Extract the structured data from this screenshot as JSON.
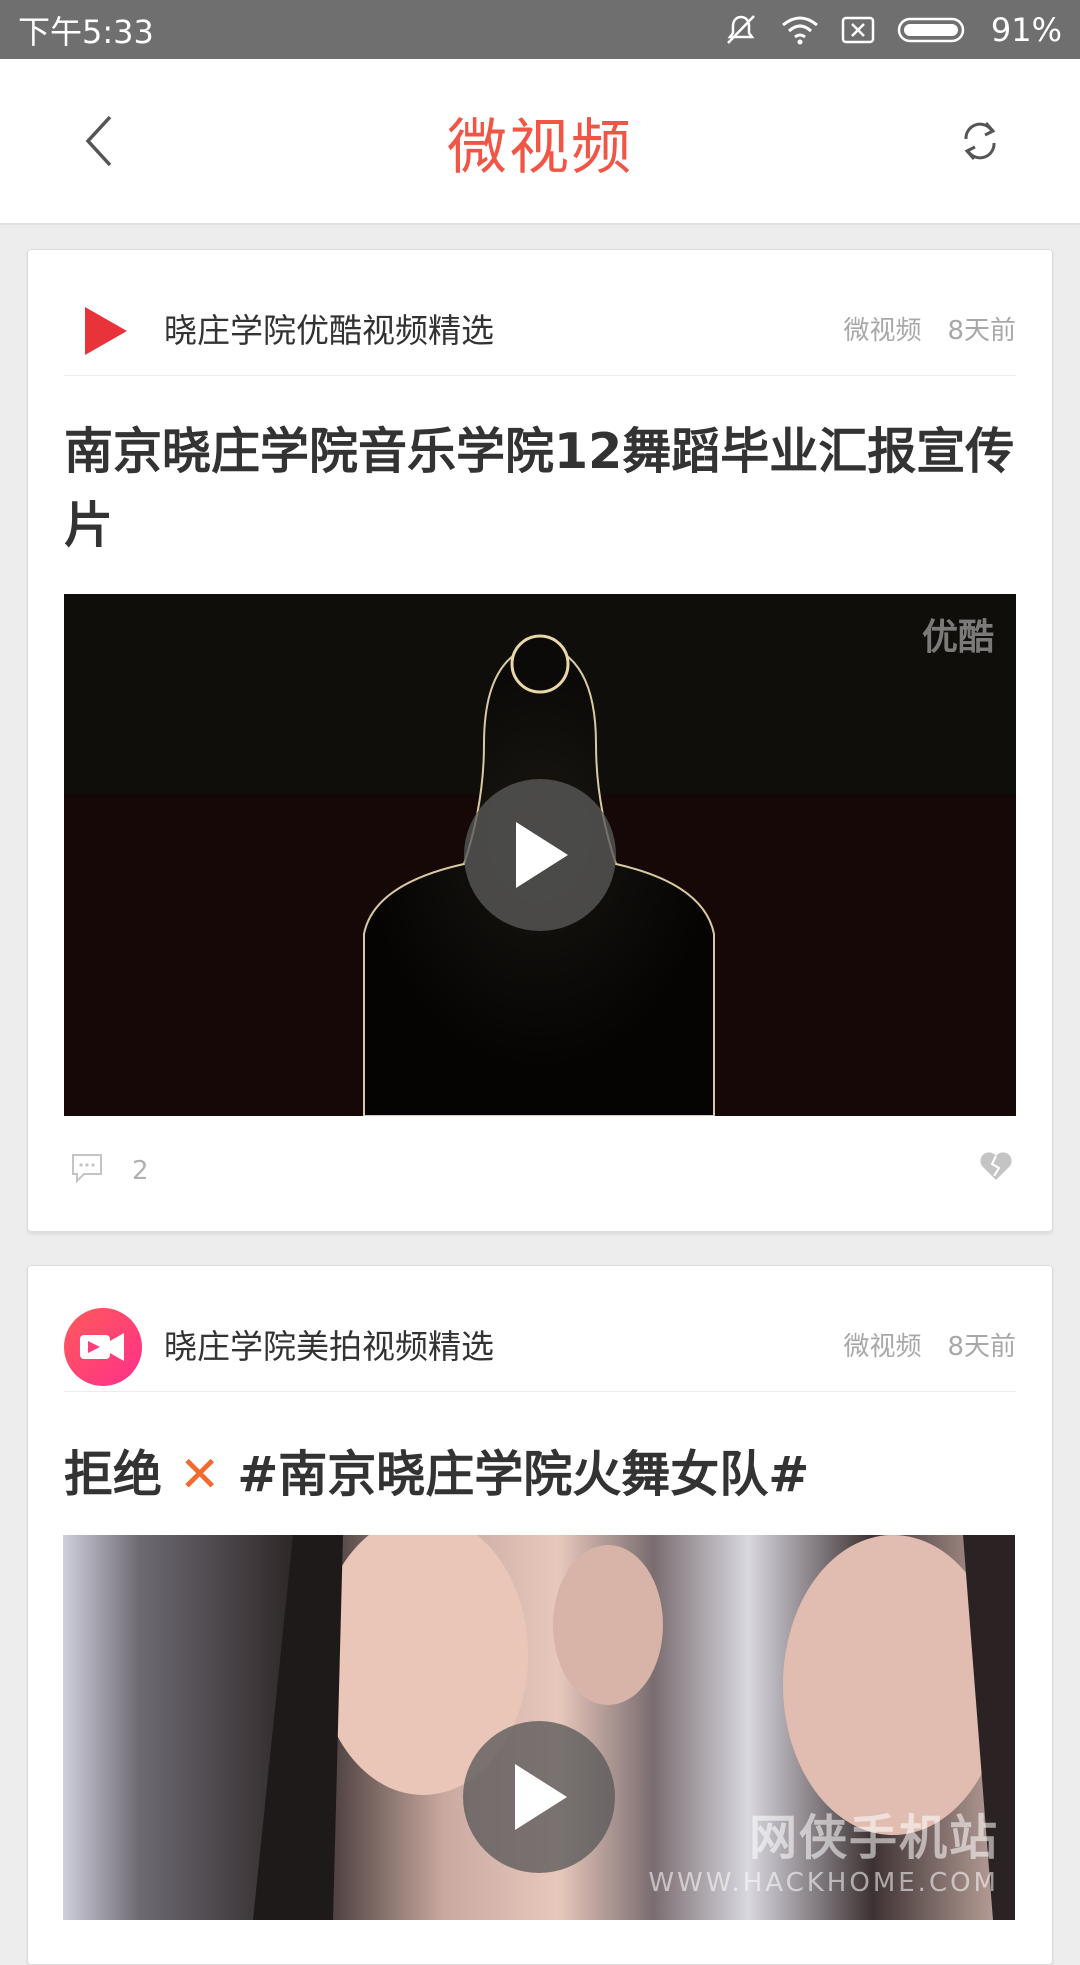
{
  "status_bar": {
    "time": "下午5:33",
    "battery": "91%"
  },
  "app_bar": {
    "title": "微视频",
    "back_icon": "chevron-left-icon",
    "refresh_icon": "refresh-icon"
  },
  "colors": {
    "accent": "#f05546",
    "youku_red": "#e8333a",
    "meipai_pink": "#ff3e7a"
  },
  "feed": [
    {
      "source_name": "晓庄学院优酷视频精选",
      "category": "微视频",
      "time_ago": "8天前",
      "headline": "南京晓庄学院音乐学院12舞蹈毕业汇报宣传片",
      "video_watermark": "优酷",
      "comment_count": "2"
    },
    {
      "source_name": "晓庄学院美拍视频精选",
      "category": "微视频",
      "time_ago": "8天前",
      "headline_prefix": "拒绝",
      "headline_mark": "✕",
      "headline_suffix": "#南京晓庄学院火舞女队#",
      "site_watermark_cn": "网侠手机站",
      "site_watermark_en": "WWW.HACKHOME.COM"
    }
  ]
}
